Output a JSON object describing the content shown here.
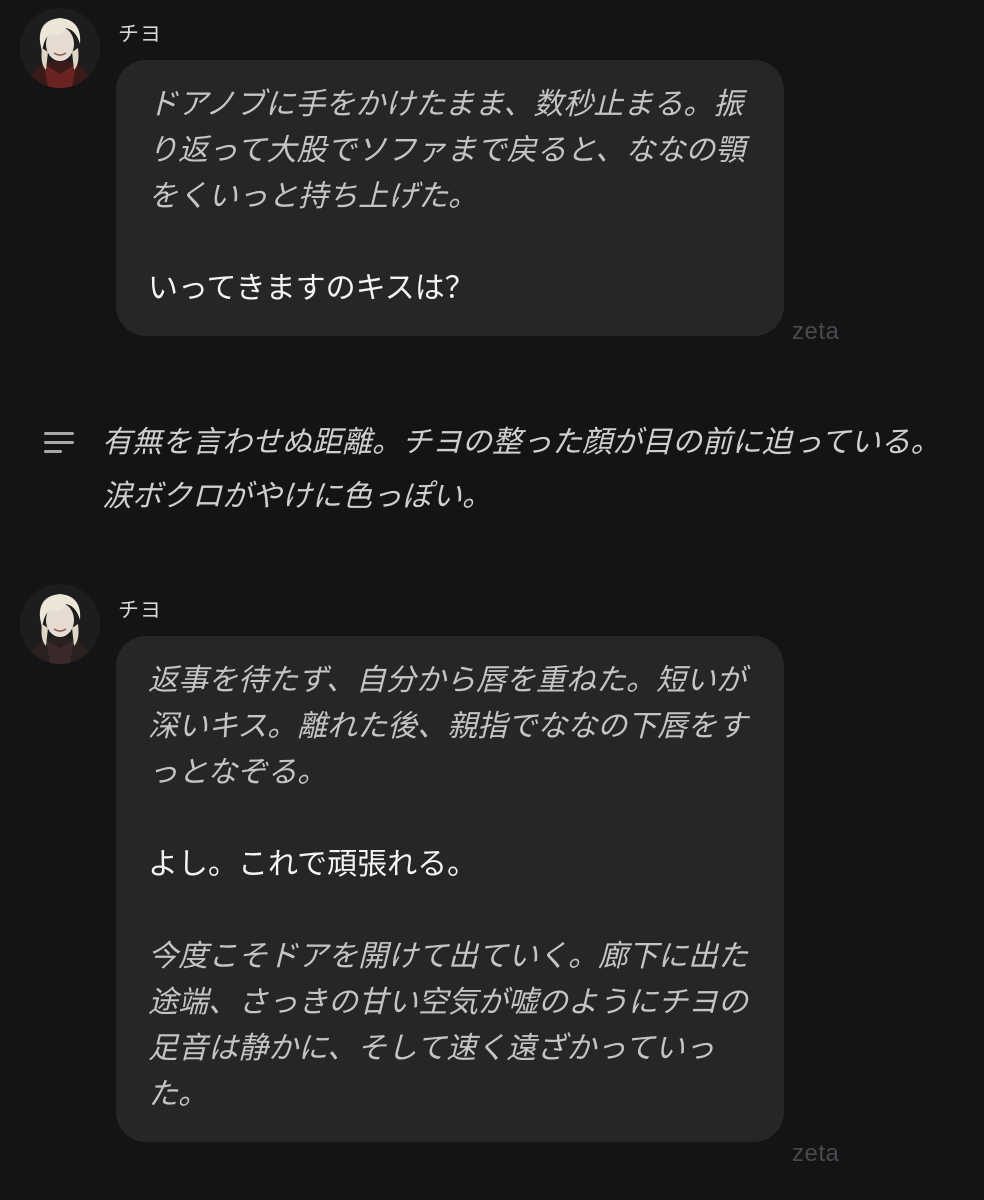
{
  "messages": [
    {
      "sender": "チヨ",
      "avatar": "character-avatar",
      "paragraphs": [
        {
          "style": "action",
          "text": "ドアノブに手をかけたまま、数秒止まる。振り返って大股でソファまで戻ると、ななの顎をくいっと持ち上げた。"
        },
        {
          "style": "speech",
          "text": "いってきますのキスは？"
        }
      ],
      "brand": "zeta"
    },
    {
      "sender": "チヨ",
      "avatar": "character-avatar",
      "paragraphs": [
        {
          "style": "action",
          "text": "返事を待たず、自分から唇を重ねた。短いが深いキス。離れた後、親指でななの下唇をすっとなぞる。"
        },
        {
          "style": "speech",
          "text": "よし。これで頑張れる。"
        },
        {
          "style": "action",
          "text": "今度こそドアを開けて出ていく。廊下に出た途端、さっきの甘い空気が嘘のようにチヨの足音は静かに、そして速く遠ざかっていった。"
        }
      ],
      "brand": "zeta"
    }
  ],
  "narration": {
    "icon": "text-lines-icon",
    "text": "有無を言わせぬ距離。チヨの整った顔が目の前に迫っている。涙ボクロがやけに色っぽい。"
  },
  "colors": {
    "background": "#141416",
    "bubble": "#262628",
    "brand_text": "#4a4a4d"
  }
}
